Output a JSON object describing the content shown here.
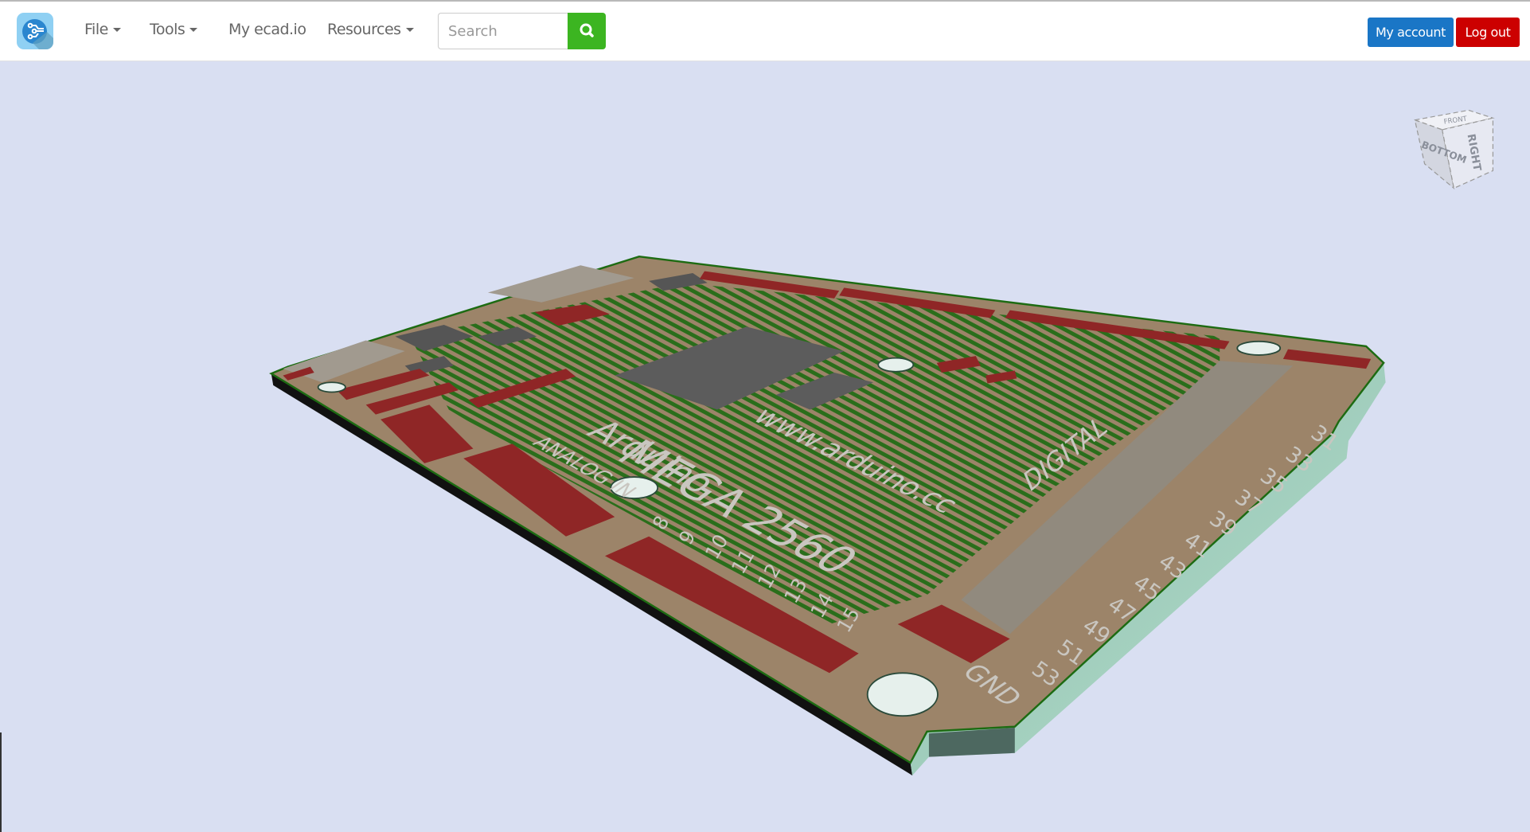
{
  "navbar": {
    "logo_icon": "ecad-circuit-logo",
    "menu": [
      {
        "label": "File",
        "has_dropdown": true
      },
      {
        "label": "Tools",
        "has_dropdown": true
      },
      {
        "label": "My ecad.io",
        "has_dropdown": false
      },
      {
        "label": "Resources",
        "has_dropdown": true
      }
    ],
    "search": {
      "placeholder": "Search",
      "value": "",
      "button_icon": "search-icon"
    },
    "my_account_label": "My account",
    "logout_label": "Log out"
  },
  "viewer": {
    "background": "#d9dff2",
    "view_cube": {
      "faces": [
        "RIGHT",
        "BOTTOM",
        "FRONT"
      ]
    },
    "board_silkscreen": {
      "brand": "Arduino",
      "model": "MEGA 2560",
      "url": "www.arduino.cc",
      "analog_label": "ANALOG IN",
      "digital_label": "DIGITAL",
      "gnd_label": "GND",
      "analog_pins": [
        "8",
        "9",
        "10",
        "11",
        "12",
        "13",
        "14",
        "15"
      ],
      "digital_pins_odd": [
        "31",
        "33",
        "35",
        "37",
        "39",
        "41",
        "43",
        "45",
        "47",
        "49",
        "51",
        "53"
      ]
    },
    "colors": {
      "board_top": "#9c8469",
      "traces": "#1d6b12",
      "pads": "#8f2626",
      "connector": "#918a7e",
      "chip": "#5a5a5a",
      "edge": "#9fcdbc",
      "underside": "#111111"
    }
  }
}
